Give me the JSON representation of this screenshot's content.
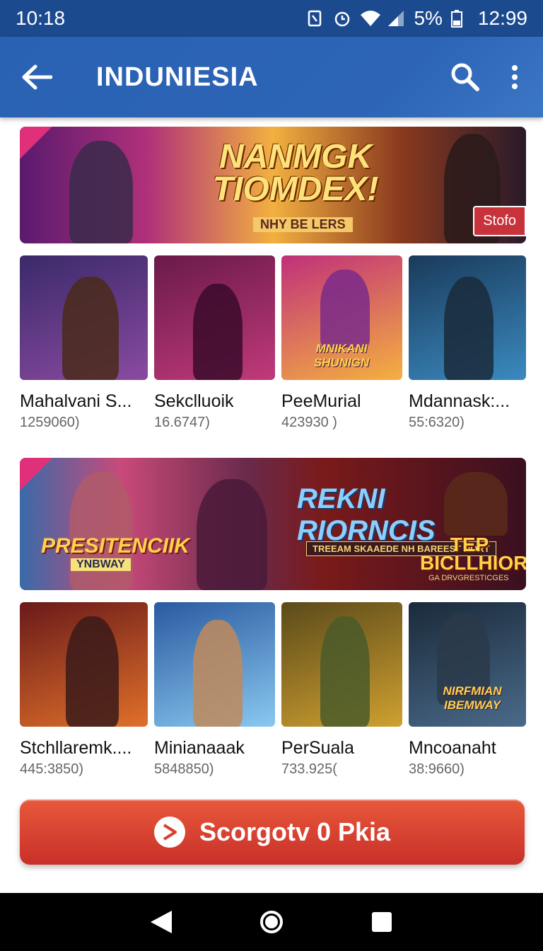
{
  "status_bar": {
    "time_left": "10:18",
    "battery": "5%",
    "time_right": "12:99"
  },
  "app_bar": {
    "title": "INDUNIESIA"
  },
  "banner_1": {
    "title": "NANMGK TIOMDEX!",
    "subtitle": "NHY BE LERS",
    "badge": "Stofo"
  },
  "banner_2": {
    "left_title": "PRESITENCIIK",
    "left_subtitle": "YNBWAY",
    "mid_title": "REKNI RIORNCIS",
    "mid_subtitle": "TREEAM SKAAEDE NH BAREEST NORT",
    "right_title": "TEP BICLLHIOR",
    "right_subtitle": "GA DRVGRESTICGES"
  },
  "games_row_1": [
    {
      "name": "Mahalvani S...",
      "count": "1259060)",
      "thumb_color_a": "#3a2a6a",
      "thumb_color_b": "#8a4aa0"
    },
    {
      "name": "Sekclluoik",
      "count": "16.6747)",
      "thumb_color_a": "#6a1a4a",
      "thumb_color_b": "#c03a7a"
    },
    {
      "name": "PeeMurial",
      "count": "423930 )",
      "thumb_color_a": "#c0307a",
      "thumb_color_b": "#f5b040",
      "thumb_label": "MNIKANI SHUNIGN"
    },
    {
      "name": "Mdannask:...",
      "count": "55:6320)",
      "thumb_color_a": "#1a3a5a",
      "thumb_color_b": "#3a8ac0"
    }
  ],
  "games_row_2": [
    {
      "name": "Stchllaremk....",
      "count": "445:3850)",
      "thumb_color_a": "#6a1a1a",
      "thumb_color_b": "#e0702a"
    },
    {
      "name": "Minianaaak",
      "count": "5848850)",
      "thumb_color_a": "#2a5aa0",
      "thumb_color_b": "#8ac8f0"
    },
    {
      "name": "PerSuala",
      "count": "733.925(",
      "thumb_color_a": "#5a4a1a",
      "thumb_color_b": "#d0a030"
    },
    {
      "name": "Mncoanaht",
      "count": "38:9660)",
      "thumb_color_a": "#1a2a3a",
      "thumb_color_b": "#4a6a8a",
      "thumb_label": "NIRFMIAN IBEMWAY"
    }
  ],
  "cta": {
    "label": "Scorgotv 0 Pkia"
  },
  "colors": {
    "status_bar": "#1c4a8f",
    "app_bar": "#2d64b6",
    "cta": "#d8402e"
  }
}
